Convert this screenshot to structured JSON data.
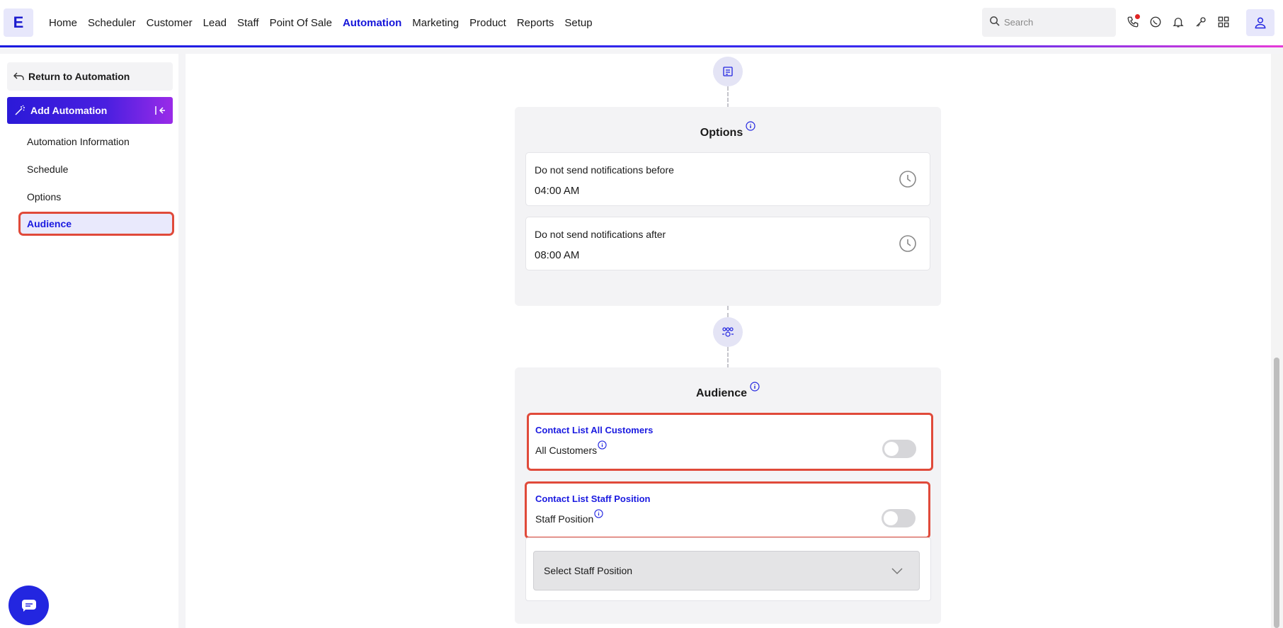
{
  "app": {
    "logo_letter": "E"
  },
  "nav": {
    "items": [
      "Home",
      "Scheduler",
      "Customer",
      "Lead",
      "Staff",
      "Point Of Sale",
      "Automation",
      "Marketing",
      "Product",
      "Reports",
      "Setup"
    ],
    "active": "Automation"
  },
  "search": {
    "placeholder": "Search"
  },
  "sidebar": {
    "return_label": "Return to Automation",
    "add_label": "Add Automation",
    "items": [
      {
        "label": "Automation Information"
      },
      {
        "label": "Schedule"
      },
      {
        "label": "Options"
      },
      {
        "label": "Audience",
        "active": true
      }
    ]
  },
  "options": {
    "title": "Options",
    "before": {
      "label": "Do not send notifications before",
      "value": "04:00 AM"
    },
    "after": {
      "label": "Do not send notifications after",
      "value": "08:00 AM"
    }
  },
  "audience": {
    "title": "Audience",
    "all_customers": {
      "heading": "Contact List All Customers",
      "label": "All Customers",
      "enabled": false
    },
    "staff_position": {
      "heading": "Contact List Staff Position",
      "label": "Staff Position",
      "enabled": false
    },
    "select_placeholder": "Select Staff Position"
  },
  "colors": {
    "accent": "#1414d9",
    "highlight": "#e04a3a",
    "gradient_start": "#2b1ad8",
    "gradient_end": "#9a2be8"
  }
}
